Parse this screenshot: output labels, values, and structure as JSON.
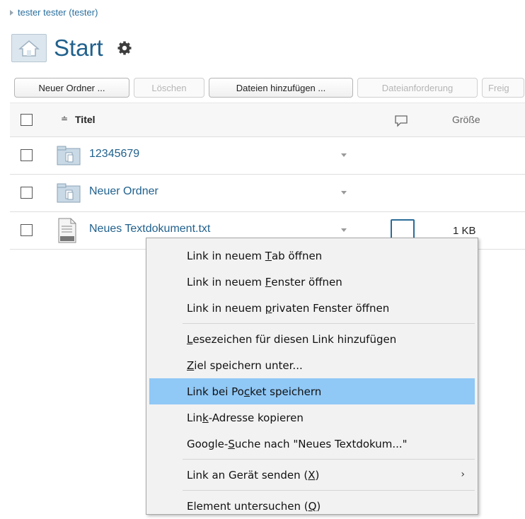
{
  "breadcrumb": {
    "user": "tester tester (tester)"
  },
  "header": {
    "title": "Start"
  },
  "toolbar": {
    "new_folder": "Neuer Ordner ...",
    "delete": "Löschen",
    "add_files": "Dateien hinzufügen ...",
    "file_request": "Dateianforderung",
    "share": "Freig"
  },
  "table": {
    "col_title": "Titel",
    "col_size": "Größe",
    "rows": [
      {
        "name": "12345679",
        "type": "folder",
        "size": ""
      },
      {
        "name": "Neuer Ordner",
        "type": "folder",
        "size": ""
      },
      {
        "name": "Neues Textdokument.txt",
        "type": "text-file",
        "size": "1 KB"
      }
    ]
  },
  "context_menu": {
    "items": [
      {
        "pre": "Link in neuem ",
        "key": "T",
        "post": "ab öffnen"
      },
      {
        "pre": "Link in neuem ",
        "key": "F",
        "post": "enster öffnen"
      },
      {
        "pre": "Link in neuem ",
        "key": "p",
        "post": "rivaten Fenster öffnen"
      },
      {
        "pre": "",
        "key": "L",
        "post": "esezeichen für diesen Link hinzufügen"
      },
      {
        "pre": "",
        "key": "Z",
        "post": "iel speichern unter..."
      },
      {
        "pre": "Link bei Po",
        "key": "c",
        "post": "ket speichern"
      },
      {
        "pre": "Lin",
        "key": "k",
        "post": "-Adresse kopieren"
      },
      {
        "pre": "Google-",
        "key": "S",
        "post": "uche nach \"Neues Textdokum...\""
      },
      {
        "pre": "Link an Gerät senden (",
        "key": "X",
        "post": ")"
      },
      {
        "pre": "Element untersuchen (",
        "key": "Q",
        "post": ")"
      }
    ],
    "highlight_color": "#90c8f6"
  },
  "colors": {
    "link": "#21618d",
    "accent": "#2b6d98"
  }
}
